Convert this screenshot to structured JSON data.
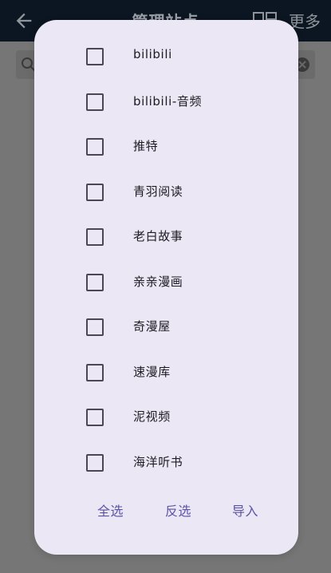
{
  "app_bar": {
    "title": "管理站点",
    "more_label": "更多",
    "icons": [
      "back-arrow-icon",
      "layout-toggle-icon"
    ]
  },
  "search": {
    "icons": [
      "search-icon",
      "clear-icon"
    ]
  },
  "dialog": {
    "options": [
      {
        "label": "bilibili",
        "checked": false
      },
      {
        "label": "bilibili-音频",
        "checked": false
      },
      {
        "label": "推特",
        "checked": false
      },
      {
        "label": "青羽阅读",
        "checked": false
      },
      {
        "label": "老白故事",
        "checked": false
      },
      {
        "label": "亲亲漫画",
        "checked": false
      },
      {
        "label": "奇漫屋",
        "checked": false
      },
      {
        "label": "速漫库",
        "checked": false
      },
      {
        "label": "泥视频",
        "checked": false
      },
      {
        "label": "海洋听书",
        "checked": false
      }
    ],
    "actions": {
      "select_all": "全选",
      "invert": "反选",
      "import": "导入"
    }
  },
  "colors": {
    "dialog_bg": "#ebe7f5",
    "accent": "#5b53a8",
    "scrim": "#767676"
  }
}
